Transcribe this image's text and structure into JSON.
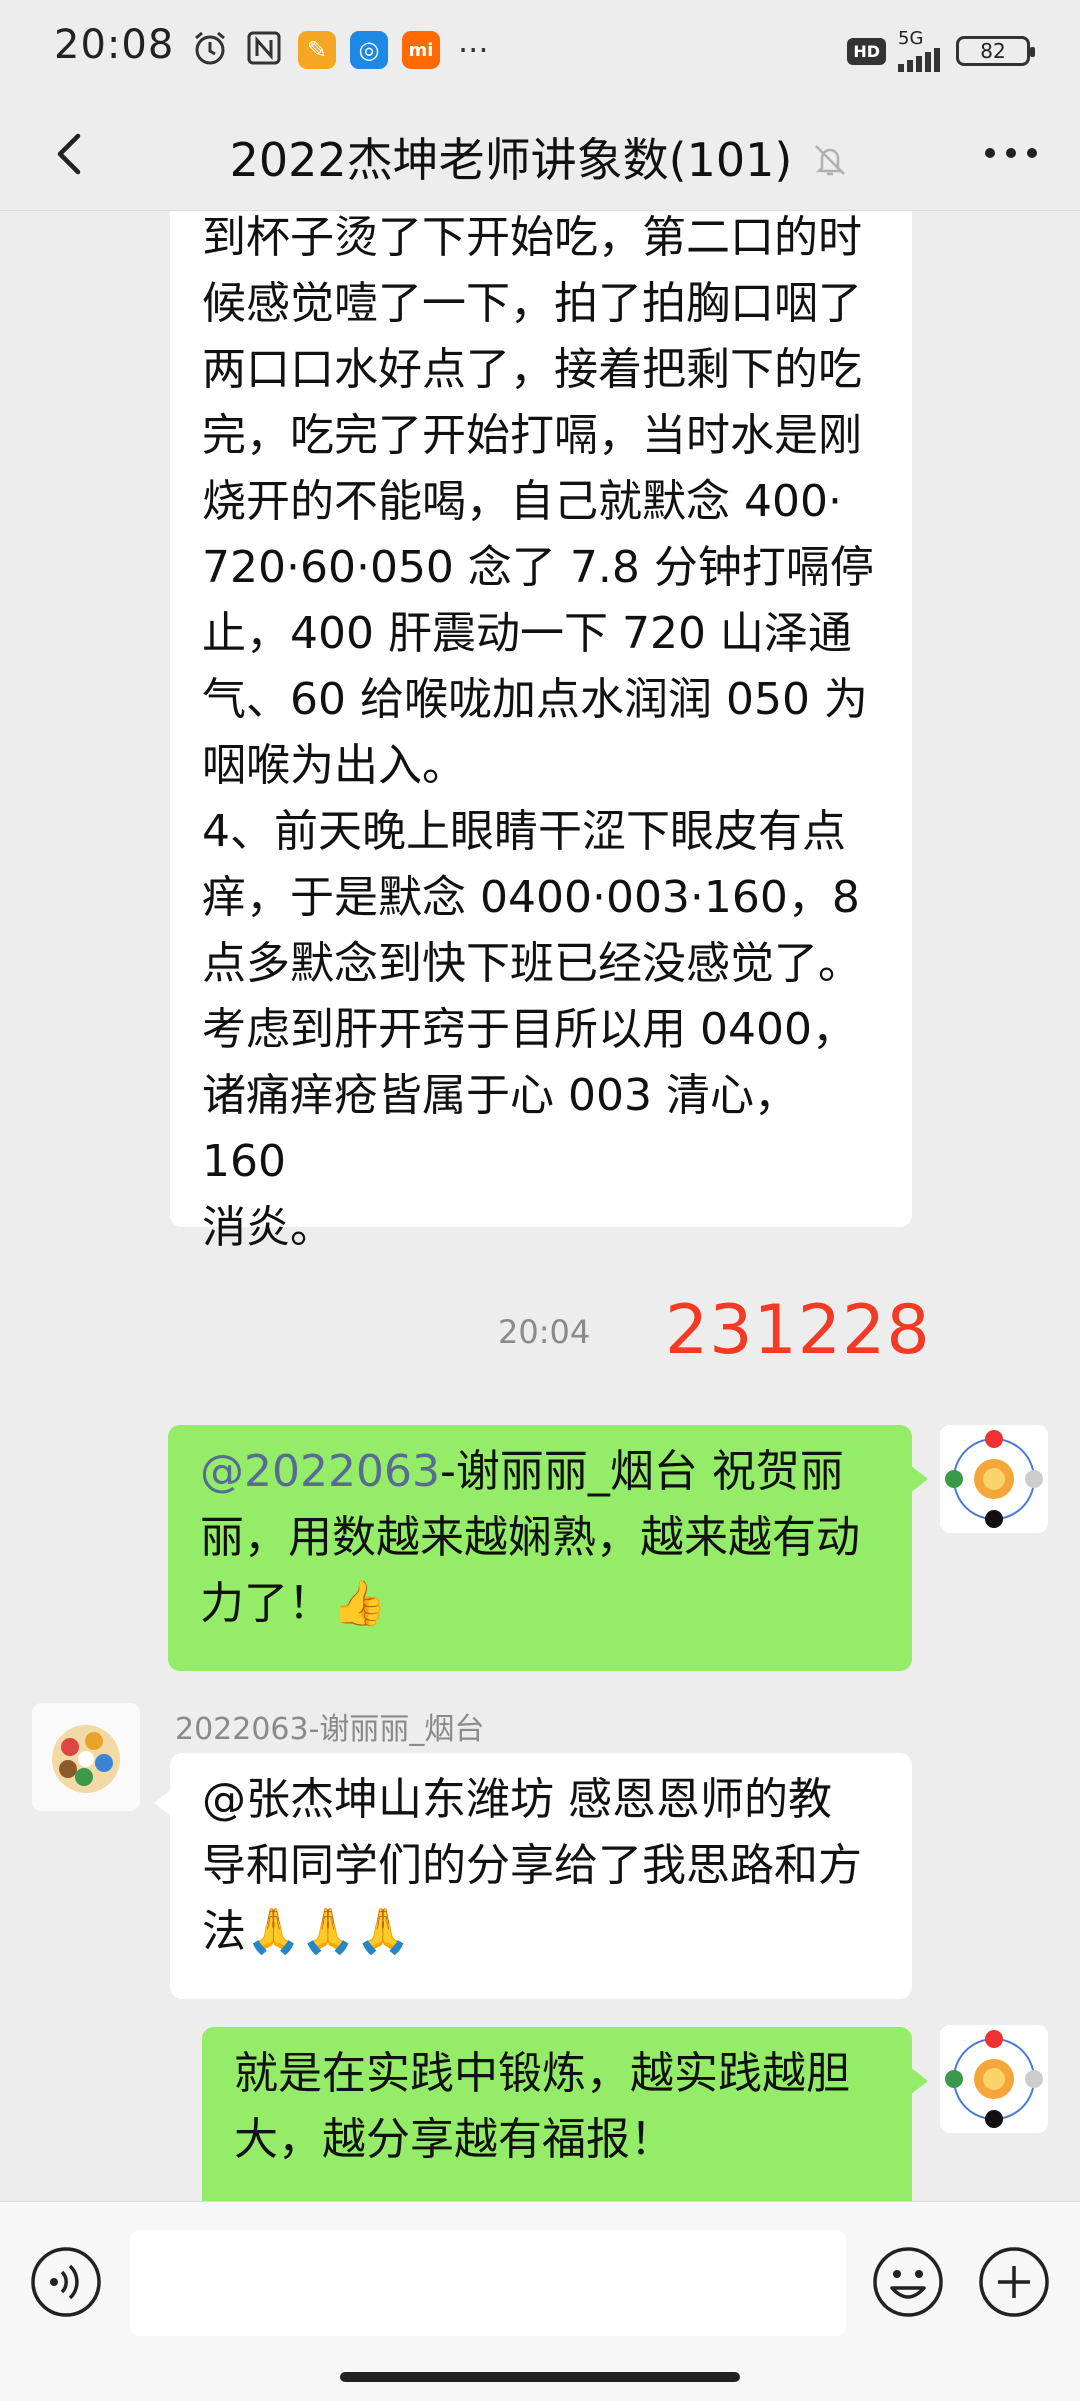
{
  "status_bar": {
    "time": "20:08",
    "network": "5G",
    "hd_badge": "HD",
    "battery": "82",
    "more_dots": "···"
  },
  "header": {
    "back_icon": "chevron-left-icon",
    "title": "2022杰坤老师讲象数(101)",
    "mute_icon": "bell-off-icon",
    "more_icon": "ellipsis-icon"
  },
  "messages": [
    {
      "side": "left",
      "lines": [
        "到杯子烫了下开始吃，第二口的时",
        "候感觉噎了一下，拍了拍胸口咽了",
        "两口口水好点了，接着把剩下的吃",
        "完，吃完了开始打嗝，当时水是刚",
        "烧开的不能喝，自己就默念 400·",
        "720·60·050 念了 7.8 分钟打嗝停",
        "止，400 肝震动一下 720 山泽通",
        "气、60 给喉咙加点水润润 050 为",
        "咽喉为出入。",
        "4、前天晚上眼睛干涩下眼皮有点",
        "痒，于是默念 0400·003·160，8",
        "点多默念到快下班已经没感觉了。",
        "考虑到肝开窍于目所以用 0400，",
        "诸痛痒疮皆属于心 003 清心，160",
        "消炎。"
      ]
    },
    {
      "side": "right",
      "mention": "@2022063",
      "line1_rest": "-谢丽丽_烟台  祝贺丽",
      "line2": "丽，用数越来越娴熟，越来越有动",
      "line3": "力了！👍"
    },
    {
      "side": "left",
      "sender": "2022063-谢丽丽_烟台",
      "lines": [
        "@张杰坤山东潍坊  感恩恩师的教",
        "导和同学们的分享给了我思路和方",
        "法🙏🙏🙏"
      ]
    },
    {
      "side": "right",
      "lines": [
        "就是在实践中锻炼，越实践越胆",
        "大，越分享越有福报！"
      ]
    }
  ],
  "timestamp": "20:04",
  "overlay_number": "231228",
  "input_bar": {
    "voice_icon": "voice-icon",
    "emoji_icon": "emoji-icon",
    "plus_icon": "plus-icon"
  },
  "colors": {
    "background": "#ededed",
    "bubble_green": "#95ec69",
    "bubble_white": "#ffffff",
    "mention": "#576b95",
    "overlay_red": "#f23a24"
  }
}
